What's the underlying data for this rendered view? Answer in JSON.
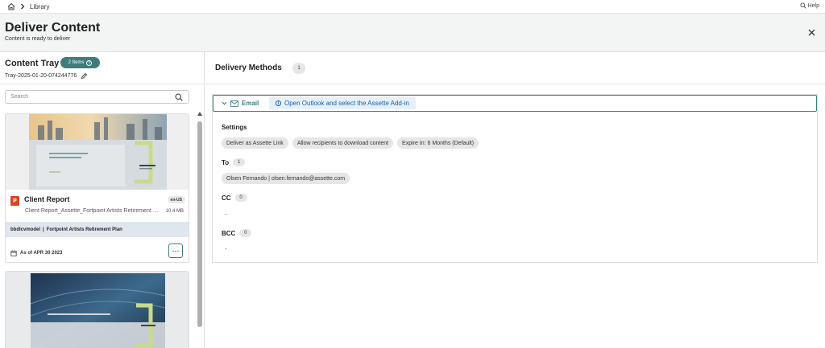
{
  "breadcrumb": {
    "items": [
      "Library"
    ]
  },
  "help_label": "Help",
  "header": {
    "title": "Deliver Content",
    "subtitle": "Content is ready to deliver"
  },
  "tray": {
    "title": "Content Tray",
    "items_badge": "2 Items",
    "tray_id": "Tray-2025-01-20-074244776",
    "search_placeholder": "Search",
    "items": [
      {
        "name": "Client Report",
        "language": "en-US",
        "file_name": "Client Report_Assette_Fortpoint Artists Retirement Plan",
        "file_size": "10.4 MB",
        "meta_user": "bbdlcvmodel",
        "meta_sep": "|",
        "meta_plan": "Fortpoint Artists Retirement Plan",
        "as_of": "As of APR 30 2023",
        "more": "⋯"
      }
    ]
  },
  "delivery": {
    "title": "Delivery Methods",
    "count": "1",
    "email": {
      "label": "Email",
      "note": "Open Outlook and select the Assette Add-in",
      "settings_label": "Settings",
      "settings": [
        "Deliver as Assette Link",
        "Allow recipients to download content",
        "Expire In: 6 Months (Default)"
      ],
      "to_label": "To",
      "to_count": "1",
      "to": [
        "Olsen Fernando | olsen.fernando@assette.com"
      ],
      "cc_label": "CC",
      "cc_count": "0",
      "cc_empty": "-",
      "bcc_label": "BCC",
      "bcc_count": "0",
      "bcc_empty": "-"
    }
  },
  "colors": {
    "accent": "#3f7c7a",
    "info": "#1d5fa5",
    "powerpoint": "#d24726"
  }
}
